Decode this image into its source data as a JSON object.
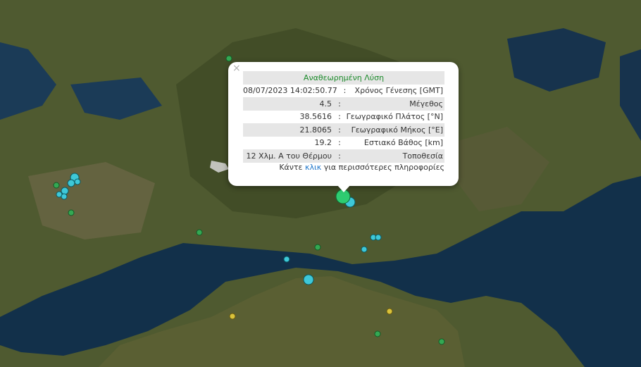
{
  "popup": {
    "close_symbol": "×",
    "status": "Αναθεωρημένη Λύση",
    "rows": [
      {
        "label": "Χρόνος Γένεσης [GMT]",
        "sep": ":",
        "value": "08/07/2023 14:02:50.77"
      },
      {
        "label": "Μέγεθος",
        "sep": ":",
        "value": "4.5"
      },
      {
        "label": "Γεωγραφικό Πλάτος [°N]",
        "sep": ":",
        "value": "38.5616"
      },
      {
        "label": "Γεωγραφικό Μήκος [°E]",
        "sep": ":",
        "value": "21.8065"
      },
      {
        "label": "Εστιακό Βάθος [km]",
        "sep": ":",
        "value": "19.2"
      },
      {
        "label": "Τοποθεσία",
        "sep": ":",
        "value": "12 Χλμ. Α του Θέρμου"
      }
    ],
    "more_prefix": "Κάντε",
    "more_link": "κλικ",
    "more_suffix": "για περισσότερες πληροφορίες"
  },
  "map": {
    "colors": {
      "sea_deep": "#0c2438",
      "sea": "#1a3a55",
      "land_green": "#4a5a2e",
      "land_brown": "#6b6244",
      "mountain": "#3a4426",
      "marker_cyan": "#3ec8d8",
      "marker_green": "#34a853",
      "marker_yellow": "#d9c23a",
      "marker_selected": "#2ecc71"
    },
    "markers": [
      {
        "color": "cyan",
        "size": "small"
      },
      {
        "color": "cyan",
        "size": "small"
      },
      {
        "color": "cyan",
        "size": "small"
      },
      {
        "color": "cyan",
        "size": "small"
      },
      {
        "color": "cyan",
        "size": "small"
      },
      {
        "color": "cyan",
        "size": "small"
      },
      {
        "color": "green",
        "size": "small"
      },
      {
        "color": "green",
        "size": "small"
      },
      {
        "color": "green",
        "size": "small"
      },
      {
        "color": "green",
        "size": "small"
      },
      {
        "color": "green",
        "size": "small"
      },
      {
        "color": "green",
        "size": "small"
      },
      {
        "color": "cyan",
        "size": "large"
      },
      {
        "color": "yellow",
        "size": "small"
      },
      {
        "color": "yellow",
        "size": "small"
      },
      {
        "color": "selected",
        "size": "large"
      }
    ]
  }
}
